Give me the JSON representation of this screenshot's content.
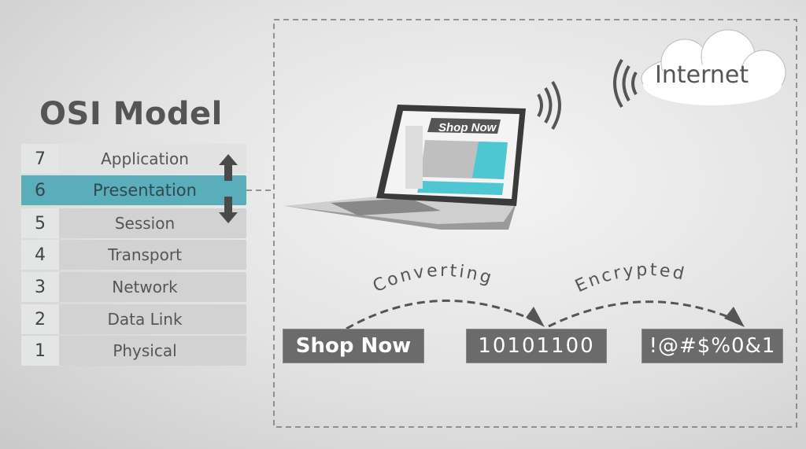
{
  "title": "OSI Model",
  "layers": [
    {
      "number": "7",
      "name": "Application"
    },
    {
      "number": "6",
      "name": "Presentation",
      "active": true
    },
    {
      "number": "5",
      "name": "Session"
    },
    {
      "number": "4",
      "name": "Transport"
    },
    {
      "number": "3",
      "name": "Network"
    },
    {
      "number": "2",
      "name": "Data Link"
    },
    {
      "number": "1",
      "name": "Physical"
    }
  ],
  "cloud_label": "Internet",
  "screen_banner": "Shop Now",
  "flow": {
    "steps": [
      "Shop Now",
      "10101100",
      "!@#$%0&1"
    ],
    "transitions": [
      "Converting",
      "Encrypted"
    ]
  },
  "colors": {
    "active_layer": "#5aaebc",
    "box": "#6b6b6b",
    "text": "#555555"
  }
}
